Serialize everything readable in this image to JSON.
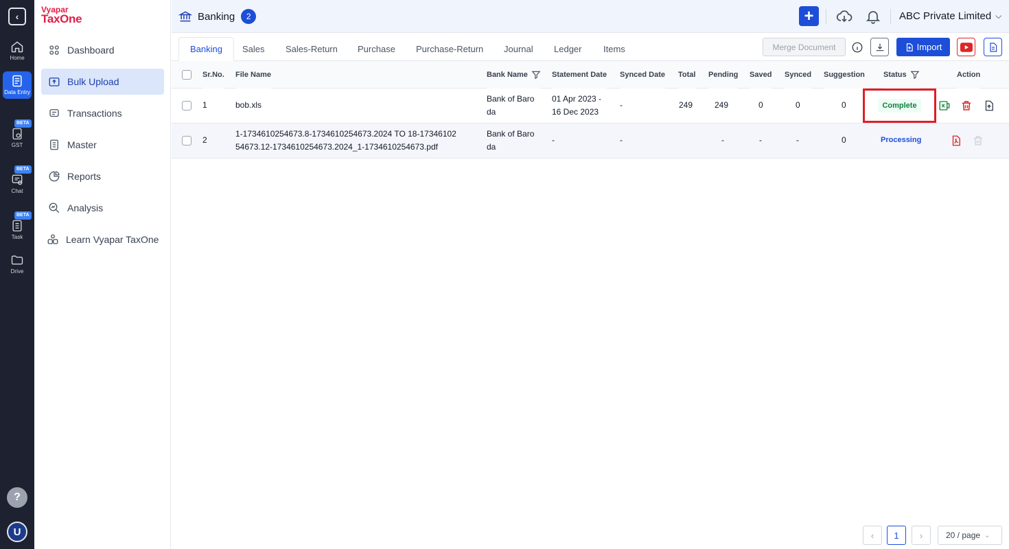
{
  "rail": {
    "items": [
      {
        "label": "Home",
        "icon": "home-icon"
      },
      {
        "label": "Data Entry",
        "icon": "data-entry-icon",
        "active": true
      },
      {
        "label": "GST",
        "icon": "gst-icon",
        "badge": "BETA"
      },
      {
        "label": "Chat",
        "icon": "chat-icon",
        "badge": "BETA"
      },
      {
        "label": "Task",
        "icon": "task-icon",
        "badge": "BETA"
      },
      {
        "label": "Drive",
        "icon": "folder-icon"
      }
    ],
    "help": "?",
    "avatar": "U"
  },
  "brand": {
    "line1": "Vyapar",
    "line2": "TaxOne"
  },
  "sidebar": {
    "items": [
      {
        "label": "Dashboard",
        "icon": "dashboard-icon"
      },
      {
        "label": "Bulk Upload",
        "icon": "upload-icon",
        "active": true
      },
      {
        "label": "Transactions",
        "icon": "transactions-icon"
      },
      {
        "label": "Master",
        "icon": "master-icon"
      },
      {
        "label": "Reports",
        "icon": "reports-icon"
      },
      {
        "label": "Analysis",
        "icon": "analysis-icon"
      },
      {
        "label": "Learn Vyapar TaxOne",
        "icon": "learn-icon"
      }
    ]
  },
  "header": {
    "title": "Banking",
    "count": "2",
    "company": "ABC Private Limited"
  },
  "tabs": [
    "Banking",
    "Sales",
    "Sales-Return",
    "Purchase",
    "Purchase-Return",
    "Journal",
    "Ledger",
    "Items"
  ],
  "toolbar": {
    "merge": "Merge Document",
    "import": "Import"
  },
  "table": {
    "columns": [
      "Sr.No.",
      "File Name",
      "Bank Name",
      "Statement Date",
      "Synced Date",
      "Total",
      "Pending",
      "Saved",
      "Synced",
      "Suggestion",
      "Status",
      "Action"
    ],
    "rows": [
      {
        "sr": "1",
        "file_l1": "bob.xls",
        "file_l2": "",
        "bank_l1": "Bank of Baro",
        "bank_l2": "da",
        "stmt_l1": "01 Apr 2023 -",
        "stmt_l2": "16 Dec 2023",
        "synced_date": "-",
        "total": "249",
        "pending": "249",
        "saved": "0",
        "synced": "0",
        "suggestion": "0",
        "status": "Complete"
      },
      {
        "sr": "2",
        "file_l1": "1-1734610254673.8-1734610254673.2024 TO 18-17346102",
        "file_l2": "54673.12-1734610254673.2024_1-1734610254673.pdf",
        "bank_l1": "Bank of Baro",
        "bank_l2": "da",
        "stmt_l1": "-",
        "stmt_l2": "",
        "synced_date": "-",
        "total": "",
        "pending": "-",
        "saved": "-",
        "synced": "-",
        "suggestion": "0",
        "status": "Processing"
      }
    ]
  },
  "pagination": {
    "current": "1",
    "page_size": "20 / page"
  }
}
